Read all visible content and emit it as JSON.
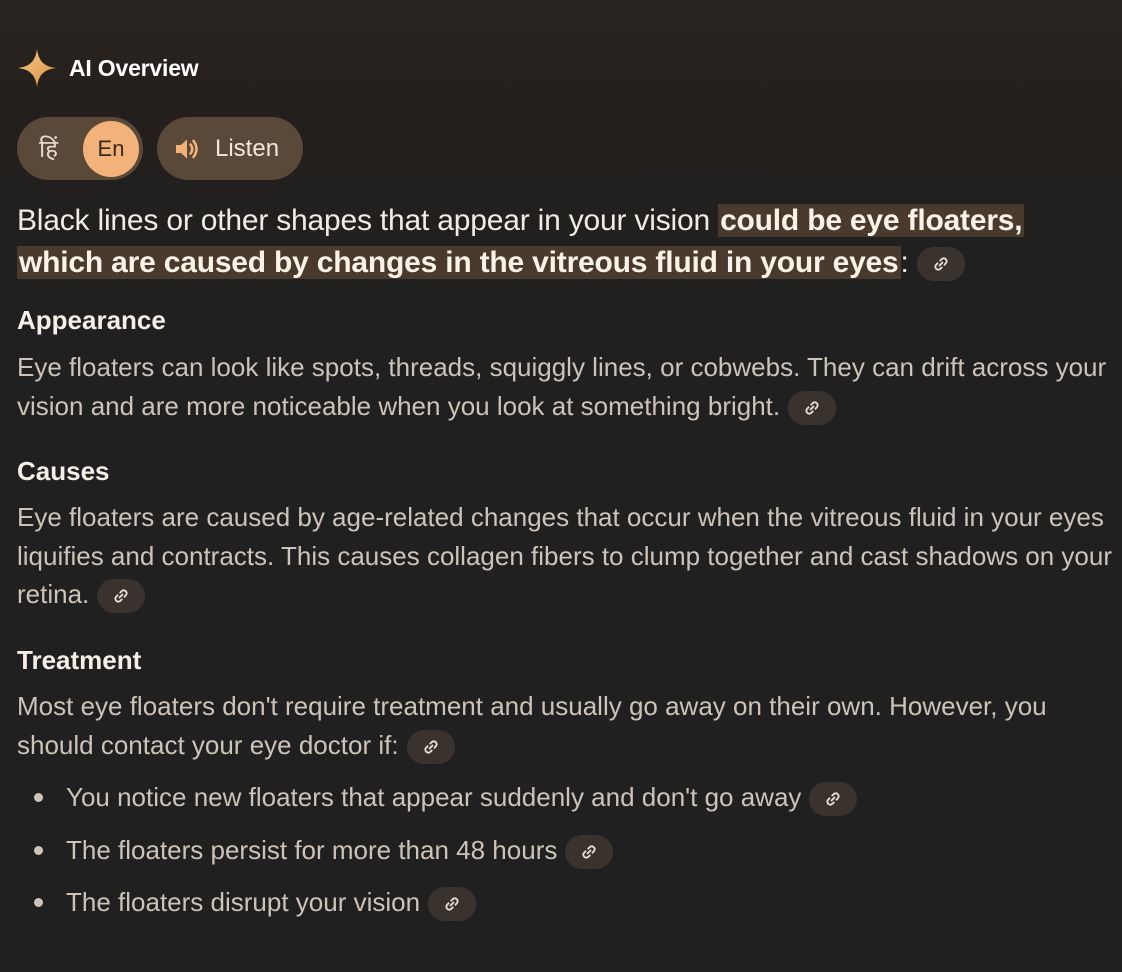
{
  "header": {
    "title": "AI Overview",
    "icon": "sparkle-icon"
  },
  "language": {
    "hindi_label": "हिं",
    "english_label": "En",
    "selected": "En"
  },
  "listen": {
    "label": "Listen",
    "icon": "speaker-icon"
  },
  "intro": {
    "text_plain": "Black lines or other shapes that appear in your vision ",
    "text_highlight": "could be eye floaters, which are caused by changes in the vitreous fluid in your eyes",
    "text_end": ":"
  },
  "sections": [
    {
      "title": "Appearance",
      "body": "Eye floaters can look like spots, threads, squiggly lines, or cobwebs. They can drift across your vision and are more noticeable when you look at something bright."
    },
    {
      "title": "Causes",
      "body": "Eye floaters are caused by age-related changes that occur when the vitreous fluid in your eyes liquifies and contracts. This causes collagen fibers to clump together and cast shadows on your retina."
    },
    {
      "title": "Treatment",
      "body": "Most eye floaters don't require treatment and usually go away on their own. However, you should contact your eye doctor if:"
    }
  ],
  "bullets": [
    "You notice new floaters that appear suddenly and don't go away",
    "The floaters persist for more than 48 hours",
    "The floaters disrupt your vision"
  ],
  "colors": {
    "accent": "#f3b27a",
    "chip_background": "#5a4838",
    "highlight_background": "#4a3a2d",
    "page_background": "#202020"
  }
}
